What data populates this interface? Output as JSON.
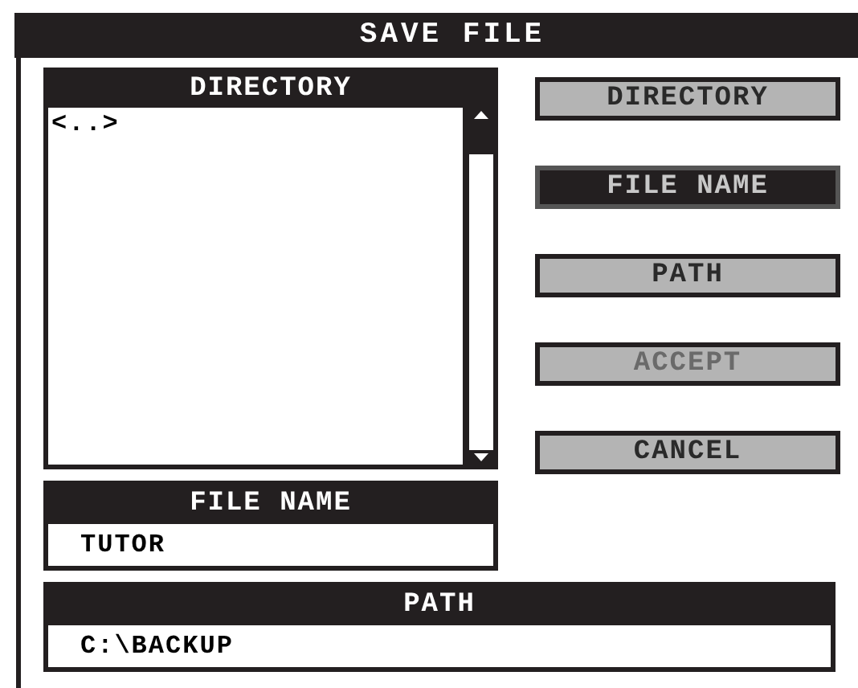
{
  "window": {
    "title": "SAVE FILE"
  },
  "directory": {
    "title": "DIRECTORY",
    "items": [
      "<..>"
    ]
  },
  "buttons": [
    {
      "label": "DIRECTORY",
      "selected": false,
      "disabled": false
    },
    {
      "label": "FILE NAME",
      "selected": true,
      "disabled": false
    },
    {
      "label": "PATH",
      "selected": false,
      "disabled": false
    },
    {
      "label": "ACCEPT",
      "selected": false,
      "disabled": true
    },
    {
      "label": "CANCEL",
      "selected": false,
      "disabled": false
    }
  ],
  "file_name": {
    "title": "FILE NAME",
    "value": "TUTOR"
  },
  "path": {
    "title": "PATH",
    "value": "C:\\BACKUP"
  }
}
